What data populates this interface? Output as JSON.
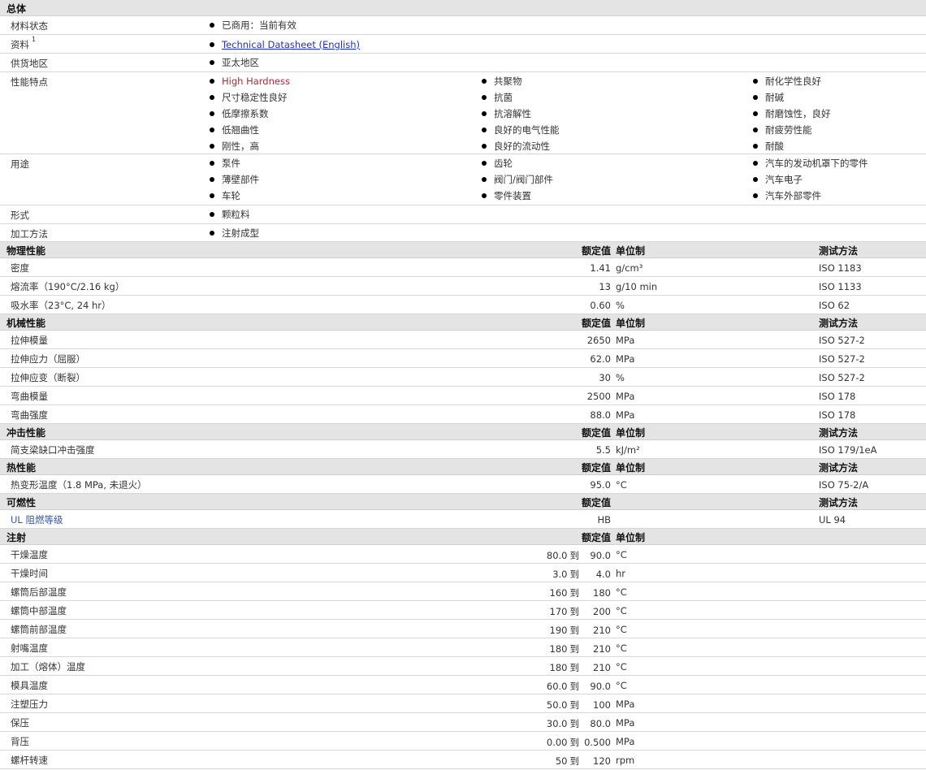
{
  "general": {
    "header": "总体",
    "material_status": {
      "label": "材料状态",
      "value": "已商用：当前有效"
    },
    "docs": {
      "label": "资料",
      "footnote": "1",
      "link": "Technical Datasheet (English)"
    },
    "region": {
      "label": "供货地区",
      "value": "亚太地区"
    },
    "features": {
      "label": "性能特点",
      "col1": [
        "High Hardness",
        "尺寸稳定性良好",
        "低摩擦系数",
        "低翘曲性",
        "刚性，高"
      ],
      "col2": [
        "共聚物",
        "抗菌",
        "抗溶解性",
        "良好的电气性能",
        "良好的流动性"
      ],
      "col3": [
        "耐化学性良好",
        "耐碱",
        "耐磨蚀性，良好",
        "耐疲劳性能",
        "耐酸"
      ]
    },
    "uses": {
      "label": "用途",
      "col1": [
        "泵件",
        "薄壁部件",
        "车轮"
      ],
      "col2": [
        "齿轮",
        "阀门/阀门部件",
        "零件装置"
      ],
      "col3": [
        "汽车的发动机罩下的零件",
        "汽车电子",
        "汽车外部零件"
      ]
    },
    "form": {
      "label": "形式",
      "value": "颗粒料"
    },
    "processing": {
      "label": "加工方法",
      "value": "注射成型"
    }
  },
  "col_headers": {
    "nominal": "额定值",
    "unit": "单位制",
    "method": "测试方法"
  },
  "physical": {
    "header": "物理性能",
    "rows": [
      {
        "label": "密度",
        "value": "1.41",
        "unit": "g/cm³",
        "method": "ISO 1183"
      },
      {
        "label": "熔流率（190°C/2.16 kg）",
        "value": "13",
        "unit": "g/10 min",
        "method": "ISO 1133"
      },
      {
        "label": "吸水率（23°C, 24 hr）",
        "value": "0.60",
        "unit": "%",
        "method": "ISO 62"
      }
    ]
  },
  "mechanical": {
    "header": "机械性能",
    "rows": [
      {
        "label": "拉伸模量",
        "value": "2650",
        "unit": "MPa",
        "method": "ISO 527-2"
      },
      {
        "label": "拉伸应力（屈服）",
        "value": "62.0",
        "unit": "MPa",
        "method": "ISO 527-2"
      },
      {
        "label": "拉伸应变（断裂）",
        "value": "30",
        "unit": "%",
        "method": "ISO 527-2"
      },
      {
        "label": "弯曲模量",
        "value": "2500",
        "unit": "MPa",
        "method": "ISO 178"
      },
      {
        "label": "弯曲强度",
        "value": "88.0",
        "unit": "MPa",
        "method": "ISO 178"
      }
    ]
  },
  "impact": {
    "header": "冲击性能",
    "rows": [
      {
        "label": "简支梁缺口冲击强度",
        "value": "5.5",
        "unit": "kJ/m²",
        "method": "ISO 179/1eA"
      }
    ]
  },
  "thermal": {
    "header": "热性能",
    "rows": [
      {
        "label": "热变形温度（1.8 MPa, 未退火）",
        "value": "95.0",
        "unit": "°C",
        "method": "ISO 75-2/A"
      }
    ]
  },
  "flammability": {
    "header": "可燃性",
    "rows": [
      {
        "label": "UL 阻燃等级",
        "value": "HB",
        "unit": "",
        "method": "UL 94"
      }
    ]
  },
  "injection": {
    "header": "注射",
    "range_word": "到",
    "rows": [
      {
        "label": "干燥温度",
        "from": "80.0",
        "to": "90.0",
        "unit": "°C"
      },
      {
        "label": "干燥时间",
        "from": "3.0",
        "to": "4.0",
        "unit": "hr"
      },
      {
        "label": "螺筒后部温度",
        "from": "160",
        "to": "180",
        "unit": "°C"
      },
      {
        "label": "螺筒中部温度",
        "from": "170",
        "to": "200",
        "unit": "°C"
      },
      {
        "label": "螺筒前部温度",
        "from": "190",
        "to": "210",
        "unit": "°C"
      },
      {
        "label": "射嘴温度",
        "from": "180",
        "to": "210",
        "unit": "°C"
      },
      {
        "label": "加工（熔体）温度",
        "from": "180",
        "to": "210",
        "unit": "°C"
      },
      {
        "label": "模具温度",
        "from": "60.0",
        "to": "90.0",
        "unit": "°C"
      },
      {
        "label": "注塑压力",
        "from": "50.0",
        "to": "100",
        "unit": "MPa"
      },
      {
        "label": "保压",
        "from": "30.0",
        "to": "80.0",
        "unit": "MPa"
      },
      {
        "label": "背压",
        "from": "0.00",
        "to": "0.500",
        "unit": "MPa"
      },
      {
        "label": "螺杆转速",
        "from": "50",
        "to": "120",
        "unit": "rpm"
      }
    ]
  }
}
